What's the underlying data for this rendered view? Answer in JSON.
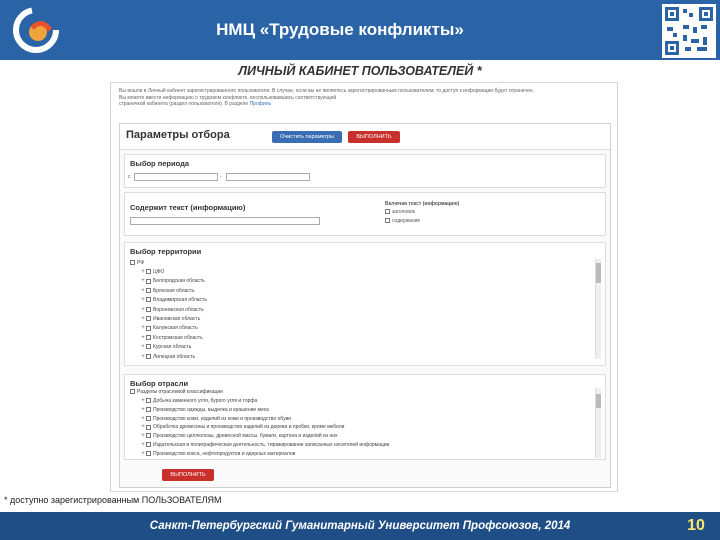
{
  "header": {
    "title": "НМЦ «Трудовые конфликты»",
    "logo_icon": "university-logo-icon",
    "qr_icon": "qr-code-icon"
  },
  "cabinet_title": "ЛИЧНЫЙ КАБИНЕТ ПОЛЬЗОВАТЕЛЕЙ *",
  "screenshot": {
    "intro_line1": "Вы вошли в Личный кабинет зарегистрированного пользователя. В случае, если вы не являетесь зарегистрированным пользователем, то доступ к информации будет ограничен.",
    "intro_line2": "Вы можете ввести информацию о трудовом конфликте, воспользовавшись соответствующей",
    "intro_line3": "страничкой кабинета (раздел пользователя). В разделе",
    "intro_link": "Профиль",
    "panel_title": "Параметры отбора",
    "clear_button": "Очистить параметры",
    "run_button": "ВЫПОЛНИТЬ",
    "period": {
      "title": "Выбор периода",
      "from_value": "",
      "to_value": ""
    },
    "text": {
      "title": "Содержит текст (информацию)",
      "value": "",
      "include_label": "Включая текст (информацию)",
      "option1": "заголовок",
      "option2": "содержание"
    },
    "territory": {
      "title": "Выбор территории",
      "root": "РФ",
      "items": [
        "ЦФО",
        "Белгородская область",
        "Брянская область",
        "Владимирская область",
        "Воронежская область",
        "Ивановская область",
        "Калужская область",
        "Костромская область",
        "Курская область",
        "Липецкая область"
      ]
    },
    "industry": {
      "title": "Выбор отрасли",
      "root": "Разделы отраслевой классификации",
      "items": [
        "Добыча каменного угля, бурого угля и торфа",
        "Производство одежды, выделка и крашение меха",
        "Производство кожи, изделий из кожи и производство обуви",
        "Обработка древесины и производство изделий из дерева и пробки, кроме мебели",
        "Производство целлюлозы, древесной массы, бумаги, картона и изделий из них",
        "Издательская и полиграфическая деятельность, тиражирование записанных носителей информации",
        "Производство кокса, нефтепродуктов и ядерных материалов"
      ]
    },
    "bottom_button": "ВЫПОЛНИТЬ"
  },
  "note": "* доступно зарегистрированным ПОЛЬЗОВАТЕЛЯМ",
  "footer": {
    "text": "Санкт-Петербургский Гуманитарный Университет Профсоюзов, 2014",
    "page_number": "10"
  },
  "colors": {
    "header_bg": "#2a64a6",
    "footer_bg": "#1f4e86",
    "run_button": "#c9302c",
    "clear_button": "#3a6eb4",
    "page_number": "#ffe36a"
  }
}
